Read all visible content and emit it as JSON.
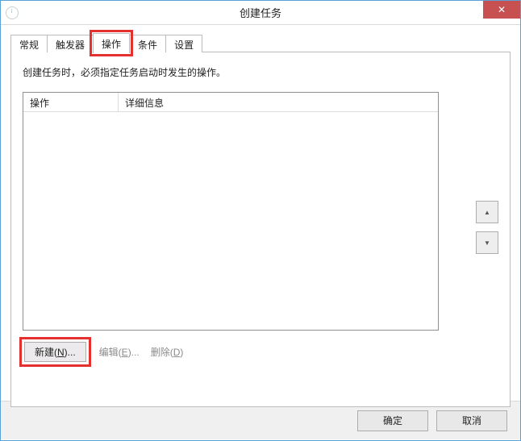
{
  "window": {
    "title": "创建任务"
  },
  "tabs": {
    "general": "常规",
    "triggers": "触发器",
    "actions": "操作",
    "conditions": "条件",
    "settings": "设置"
  },
  "panel": {
    "instruction": "创建任务时，必须指定任务启动时发生的操作。",
    "columns": {
      "action": "操作",
      "details": "详细信息"
    },
    "rows": []
  },
  "buttons": {
    "new_prefix": "新建(",
    "new_key": "N",
    "new_suffix": ")...",
    "edit_prefix": "编辑(",
    "edit_key": "E",
    "edit_suffix": ")...",
    "delete_prefix": "删除(",
    "delete_key": "D",
    "delete_suffix": ")"
  },
  "footer": {
    "ok": "确定",
    "cancel": "取消"
  }
}
